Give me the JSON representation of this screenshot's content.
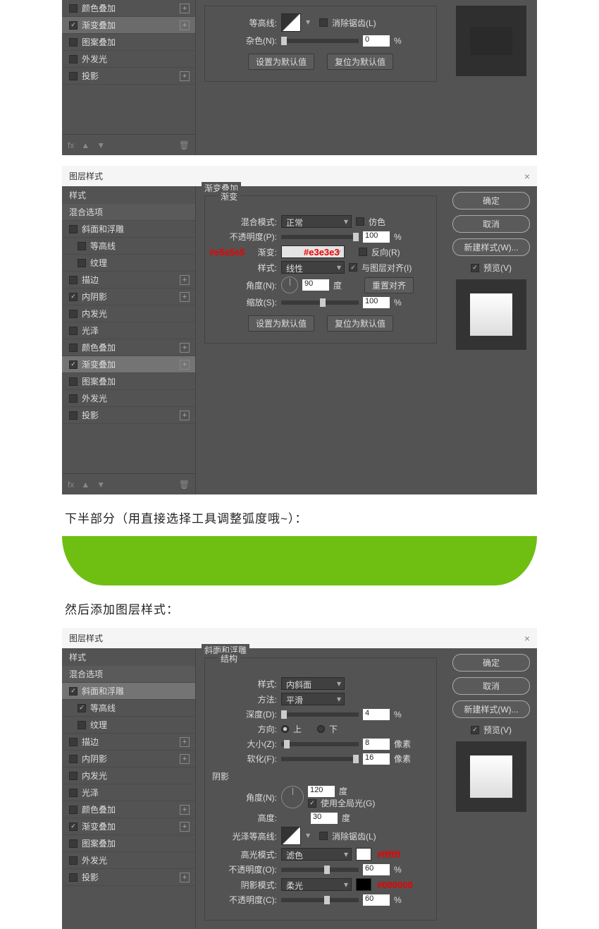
{
  "dlg_title": "图层样式",
  "close": "×",
  "side": {
    "style": "样式",
    "blend": "混合选项",
    "bevel": "斜面和浮雕",
    "contour": "等高线",
    "texture": "纹理",
    "stroke": "描边",
    "inner_shadow": "内阴影",
    "inner_glow": "内发光",
    "satin": "光泽",
    "color_overlay": "颜色叠加",
    "grad_overlay": "渐变叠加",
    "pattern_overlay": "图案叠加",
    "outer_glow": "外发光",
    "drop_shadow": "投影"
  },
  "acts": {
    "default": "设置为默认值",
    "reset": "复位为默认值",
    "ok": "确定",
    "cancel": "取消",
    "new": "新建样式(W)...",
    "preview": "预览(V)",
    "realign": "重置对齐"
  },
  "p1": {
    "contour_lbl": "等高线:",
    "aa": "消除锯齿(L)",
    "noise_lbl": "杂色(N):",
    "noise_val": "0",
    "pct": "%"
  },
  "p2": {
    "title1": "渐变叠加",
    "title2": "渐变",
    "blend_lbl": "混合模式:",
    "blend_val": "正常",
    "dither": "仿色",
    "opacity_lbl": "不透明度(P):",
    "opacity_val": "100",
    "grad_lbl": "渐变:",
    "reverse": "反向(R)",
    "style_lbl": "样式:",
    "style_val": "线性",
    "align": "与图层对齐(I)",
    "angle_lbl": "角度(N):",
    "angle_val": "90",
    "deg": "度",
    "scale_lbl": "缩放(S):",
    "scale_val": "100",
    "annot1": "#e5e5e5",
    "annot2": "#e3e3e3"
  },
  "p3": {
    "title1": "斜面和浮雕",
    "title2": "结构",
    "title3": "阴影",
    "style_lbl": "样式:",
    "style_val": "内斜面",
    "method_lbl": "方法:",
    "method_val": "平滑",
    "depth_lbl": "深度(D):",
    "depth_val": "4",
    "pct": "%",
    "dir_lbl": "方向:",
    "up": "上",
    "down": "下",
    "size_lbl": "大小(Z):",
    "size_val": "8",
    "px": "像素",
    "soft_lbl": "软化(F):",
    "soft_val": "16",
    "angle_lbl": "角度(N):",
    "angle_val": "120",
    "deg": "度",
    "global": "使用全局光(G)",
    "alt_lbl": "高度:",
    "alt_val": "30",
    "gloss_lbl": "光泽等高线:",
    "aa": "消除锯齿(L)",
    "hi_lbl": "高光模式:",
    "hi_val": "滤色",
    "hi_annot": "#ffffff",
    "hi_op_lbl": "不透明度(O):",
    "hi_op_val": "60",
    "sh_lbl": "阴影模式:",
    "sh_val": "柔光",
    "sh_annot": "#000000",
    "sh_op_lbl": "不透明度(C):",
    "sh_op_val": "60"
  },
  "cap1": "下半部分（用直接选择工具调整弧度哦~）：",
  "cap2": "然后添加图层样式：",
  "foot": {
    "fx": "fx",
    "up": "▲",
    "down": "▼",
    "trash": "🗑"
  }
}
